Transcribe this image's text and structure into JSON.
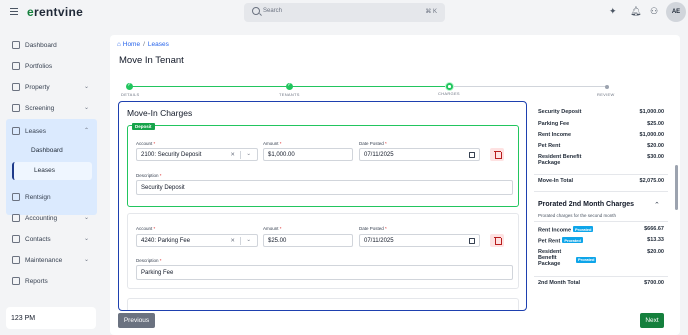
{
  "app": {
    "logo_prefix": "e",
    "logo_rest": "rentvine"
  },
  "search": {
    "placeholder": "Search",
    "shortcut": "⌘ K"
  },
  "user": {
    "initials": "AE"
  },
  "sidebar": {
    "items": [
      {
        "label": "Dashboard"
      },
      {
        "label": "Portfolios"
      },
      {
        "label": "Property"
      },
      {
        "label": "Screening"
      },
      {
        "label": "Leases"
      },
      {
        "label": "Rentsign"
      },
      {
        "label": "Accounting"
      },
      {
        "label": "Contacts"
      },
      {
        "label": "Maintenance"
      },
      {
        "label": "Reports"
      }
    ],
    "leases_sub": [
      {
        "label": "Dashboard"
      },
      {
        "label": "Leases"
      }
    ],
    "clock": "123 PM"
  },
  "breadcrumb": {
    "home": "Home",
    "leases": "Leases"
  },
  "page": {
    "title": "Move In Tenant"
  },
  "stepper": {
    "steps": [
      {
        "label": "DETAILS",
        "state": "done"
      },
      {
        "label": "TENANTS",
        "state": "done"
      },
      {
        "label": "CHARGES",
        "state": "current"
      },
      {
        "label": "REVIEW",
        "state": "todo"
      }
    ],
    "active_color": "#22c55e"
  },
  "charges": {
    "title": "Move-In Charges",
    "labels": {
      "account": "Account",
      "amount": "Amount",
      "date_posted": "Date Posted",
      "description": "Description",
      "required": "*"
    },
    "items": [
      {
        "badge": "Deposit",
        "account": "2100: Security Deposit",
        "amount": "$1,000.00",
        "date": "07/11/2025",
        "description": "Security Deposit"
      },
      {
        "account": "4240: Parking Fee",
        "amount": "$25.00",
        "date": "07/11/2025",
        "description": "Parking Fee"
      }
    ]
  },
  "summary": {
    "movein": [
      {
        "label": "Security Deposit",
        "amount": "$1,000.00"
      },
      {
        "label": "Parking Fee",
        "amount": "$25.00"
      },
      {
        "label": "Rent Income",
        "amount": "$1,000.00"
      },
      {
        "label": "Pet Rent",
        "amount": "$20.00"
      },
      {
        "label": "Resident Benefit Package",
        "amount": "$30.00"
      }
    ],
    "movein_total": {
      "label": "Move-In Total",
      "amount": "$2,075.00"
    },
    "prorated": {
      "title": "Prorated 2nd Month Charges",
      "subtitle": "Prorated charges for the second month",
      "badge": "Prorated",
      "rows": [
        {
          "label": "Rent Income",
          "amount": "$666.67"
        },
        {
          "label": "Pet Rent",
          "amount": "$13.33"
        },
        {
          "label": "Resident Benefit Package",
          "amount": "$20.00"
        }
      ],
      "total": {
        "label": "2nd Month Total",
        "amount": "$700.00"
      }
    }
  },
  "buttons": {
    "previous": "Previous",
    "next": "Next"
  },
  "colors": {
    "brand_green": "#15803d",
    "selected_border": "#1e40af",
    "sidebar_active": "#dbeafe"
  }
}
